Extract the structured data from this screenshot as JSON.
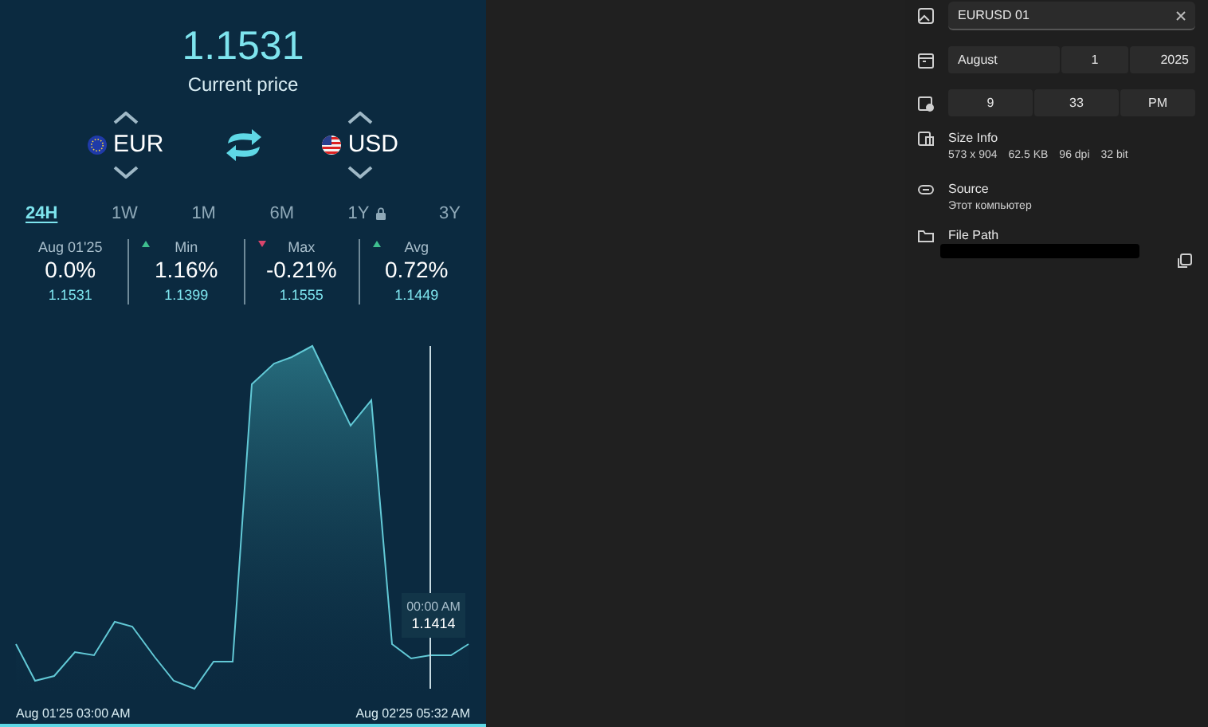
{
  "converter": {
    "price": "1.1531",
    "caption": "Current price",
    "currencies": [
      {
        "code": "EUR"
      },
      {
        "code": "USD"
      }
    ]
  },
  "ranges": [
    {
      "label": "24H",
      "selected": true,
      "locked": false
    },
    {
      "label": "1W",
      "selected": false,
      "locked": false
    },
    {
      "label": "1M",
      "selected": false,
      "locked": false
    },
    {
      "label": "6M",
      "selected": false,
      "locked": false
    },
    {
      "label": "1Y",
      "selected": false,
      "locked": true
    },
    {
      "label": "3Y",
      "selected": false,
      "locked": false
    }
  ],
  "stats": [
    {
      "label": "Aug 01'25",
      "change": "0.0%",
      "value": "1.1531",
      "kind": "plain"
    },
    {
      "label": "Min",
      "change": "1.16%",
      "value": "1.1399",
      "kind": "rising"
    },
    {
      "label": "Max",
      "change": "-0.21%",
      "value": "1.1555",
      "kind": "falling"
    },
    {
      "label": "Avg",
      "change": "0.72%",
      "value": "1.1449",
      "kind": "rising"
    }
  ],
  "chart": {
    "tooltip_time": "00:00 AM",
    "tooltip_value": "1.1414",
    "start_label": "Aug 01'25 03:00 AM",
    "end_label": "Aug 02'25 05:32 AM"
  },
  "details": {
    "title": "EURUSD 01",
    "date": [
      "August",
      "1",
      "2025"
    ],
    "time": [
      "9",
      "33",
      "PM"
    ],
    "size_label": "Size Info",
    "size_values": [
      "573 x 904",
      "62.5 KB",
      "96 dpi",
      "32 bit"
    ],
    "source_label": "Source",
    "source_value": "Этот компьютер",
    "path_label": "File Path"
  }
}
